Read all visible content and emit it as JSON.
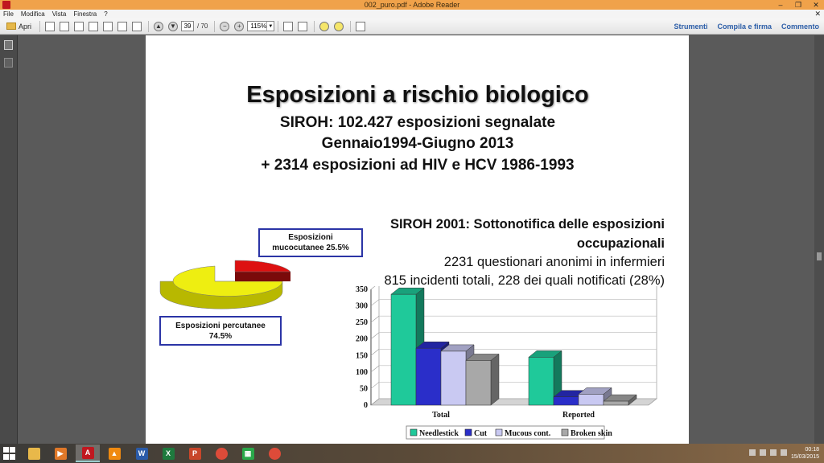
{
  "window": {
    "title": "002_puro.pdf - Adobe Reader"
  },
  "menu": [
    "File",
    "Modifica",
    "Vista",
    "Finestra",
    "?"
  ],
  "toolbar": {
    "open_label": "Apri",
    "current_page": "39",
    "total_pages": "/ 70",
    "zoom": "115%",
    "right_buttons": [
      "Strumenti",
      "Compila e firma",
      "Commento"
    ]
  },
  "slide": {
    "title": "Esposizioni a rischio biologico",
    "subtitle_lines": [
      "SIROH: 102.427 esposizioni segnalate",
      "Gennaio1994-Giugno 2013",
      "+ 2314 esposizioni ad HIV e HCV 1986-1993"
    ],
    "siroh2001_lines": [
      "SIROH 2001: Sottonotifica delle esposizioni",
      "occupazionali",
      "2231 questionari anonimi in infermieri",
      "815 incidenti totali, 228 dei quali notificati (28%)"
    ],
    "pie_labels": {
      "mucocutanee": [
        "Esposizioni",
        "mucocutanee 25.5%"
      ],
      "percutanee": [
        "Esposizioni percutanee",
        "74.5%"
      ]
    }
  },
  "chart_data": [
    {
      "type": "pie",
      "labels": [
        "Esposizioni mucocutanee",
        "Esposizioni percutanee"
      ],
      "values": [
        25.5,
        74.5
      ],
      "colors": [
        "#dd1111",
        "#eeee11"
      ]
    },
    {
      "type": "bar",
      "categories": [
        "Total",
        "Reported"
      ],
      "series": [
        {
          "name": "Needlestick",
          "values": [
            335,
            145
          ],
          "color": "#1fc99a"
        },
        {
          "name": "Cut",
          "values": [
            172,
            25
          ],
          "color": "#2a2ec9"
        },
        {
          "name": "Mucous cont.",
          "values": [
            163,
            33
          ],
          "color": "#c9c9f2"
        },
        {
          "name": "Broken skin",
          "values": [
            135,
            12
          ],
          "color": "#a8a8a8"
        }
      ],
      "ylim": [
        0,
        350
      ],
      "yticks": [
        "0",
        "50",
        "100",
        "150",
        "200",
        "250",
        "300",
        "350"
      ],
      "grid": true,
      "legend": "bottom"
    }
  ],
  "taskbar": {
    "apps": [
      {
        "name": "file-explorer",
        "glyph": "",
        "color": "#e8b84a"
      },
      {
        "name": "media-player",
        "glyph": "▶",
        "color": "#e07828"
      },
      {
        "name": "adobe-reader",
        "glyph": "A",
        "color": "#c0171f"
      },
      {
        "name": "vlc",
        "glyph": "▲",
        "color": "#f08a10"
      },
      {
        "name": "word",
        "glyph": "W",
        "color": "#2b5ba8"
      },
      {
        "name": "excel",
        "glyph": "X",
        "color": "#1e7a3e"
      },
      {
        "name": "powerpoint",
        "glyph": "P",
        "color": "#c8462a"
      },
      {
        "name": "chrome",
        "glyph": "",
        "color": "#dd4b39"
      },
      {
        "name": "calculator",
        "glyph": "▦",
        "color": "#2aa84a"
      },
      {
        "name": "chrome-2",
        "glyph": "",
        "color": "#dd4b39"
      }
    ],
    "time": "00:18",
    "date": "15/03/2015"
  }
}
